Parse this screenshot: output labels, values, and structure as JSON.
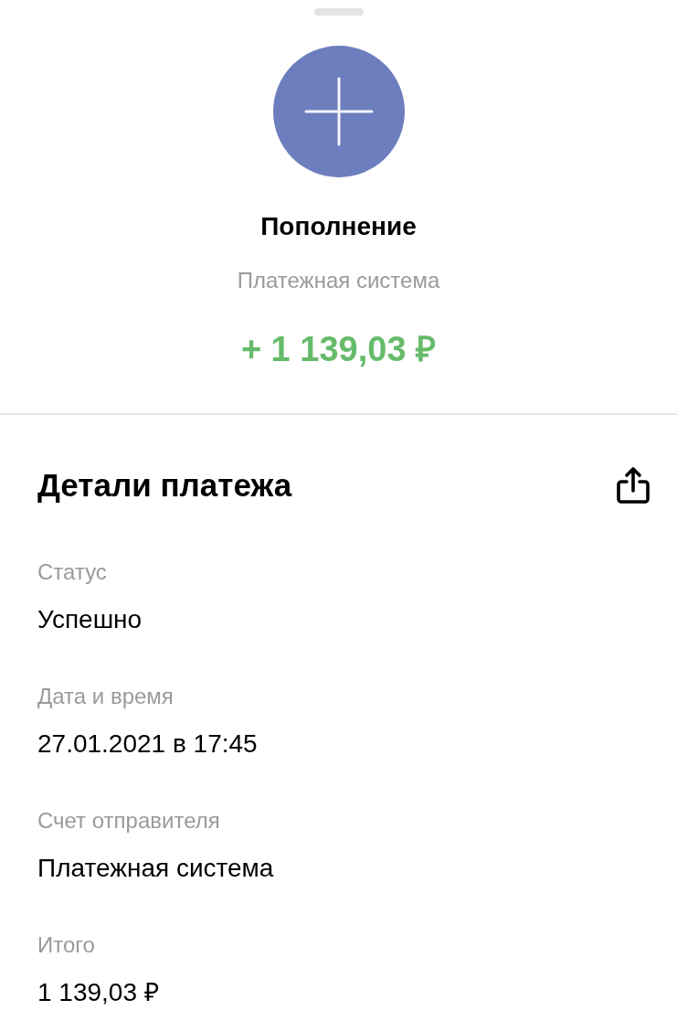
{
  "header": {
    "title": "Пополнение",
    "subtitle": "Платежная система",
    "amount": "+ 1 139,03 ₽"
  },
  "details": {
    "title": "Детали платежа",
    "fields": [
      {
        "label": "Статус",
        "value": "Успешно"
      },
      {
        "label": "Дата и время",
        "value": "27.01.2021 в 17:45"
      },
      {
        "label": "Счет отправителя",
        "value": "Платежная система"
      },
      {
        "label": "Итого",
        "value": "1 139,03 ₽"
      }
    ]
  }
}
